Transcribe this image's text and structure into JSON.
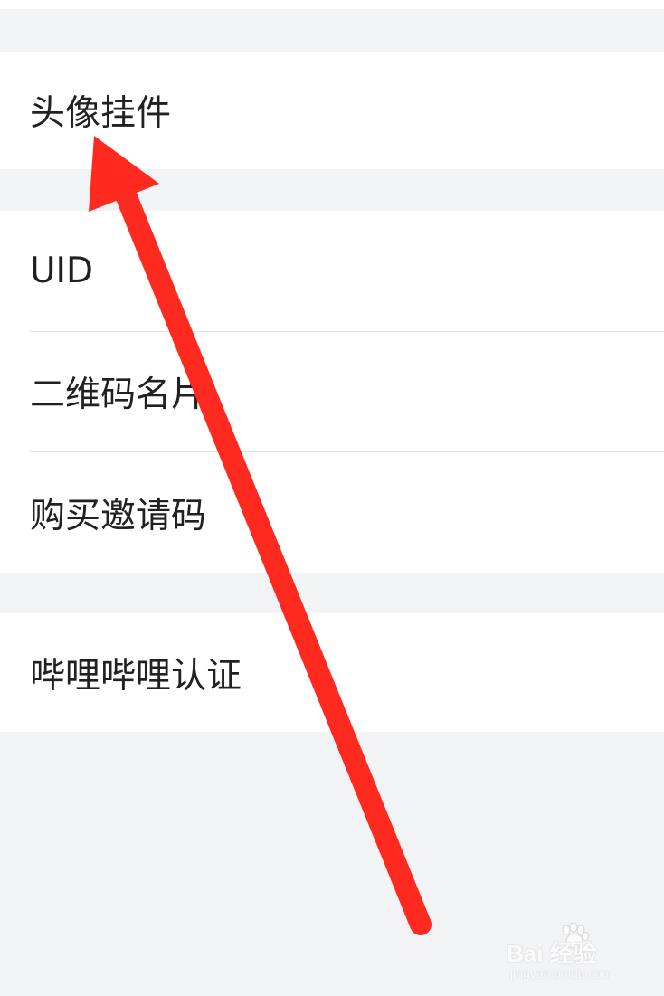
{
  "settings": {
    "items": [
      {
        "label": "头像挂件"
      },
      {
        "label": "UID"
      },
      {
        "label": "二维码名片"
      },
      {
        "label": "购买邀请码"
      },
      {
        "label": "哔哩哔哩认证"
      }
    ]
  },
  "annotation": {
    "arrow_color": "#ff2a1f"
  },
  "watermark": {
    "brand": "Bai 经验",
    "url": "jingyan.baidu.com"
  },
  "colors": {
    "background": "#f2f3f5",
    "cell": "#ffffff",
    "text": "#212121",
    "divider": "#e3e3e3"
  }
}
